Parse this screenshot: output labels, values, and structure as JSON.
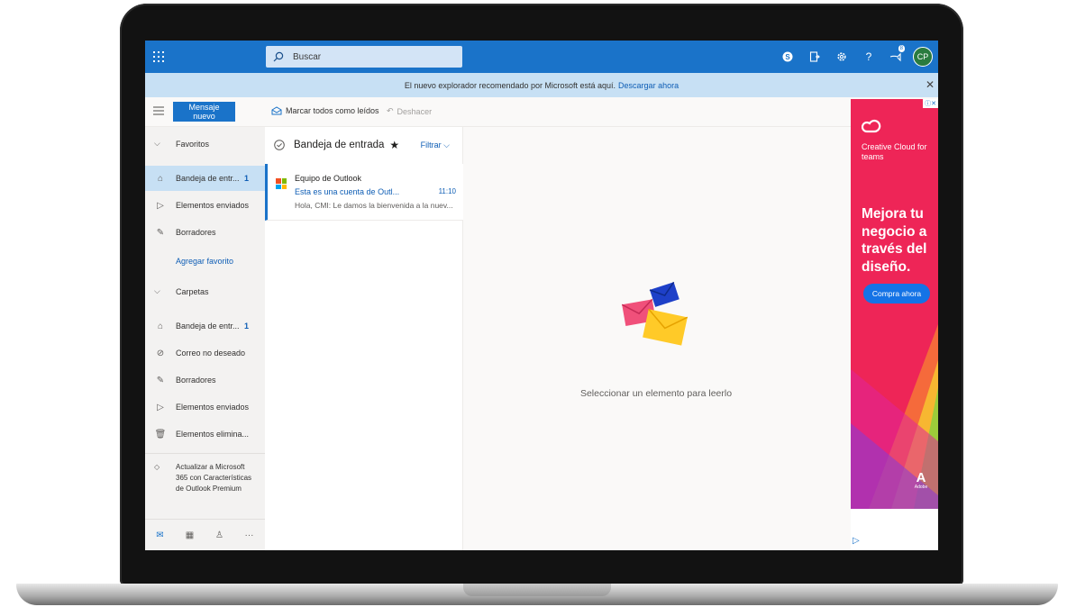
{
  "search": {
    "placeholder": "Buscar"
  },
  "header": {
    "avatar_initials": "CP",
    "notification_count": "8"
  },
  "banner": {
    "text": "El nuevo explorador recomendado por Microsoft está aquí.",
    "link": "Descargar ahora"
  },
  "toolbar": {
    "new_message": "Mensaje nuevo",
    "mark_all_read": "Marcar todos como leídos",
    "undo": "Deshacer"
  },
  "sidebar": {
    "favorites_label": "Favoritos",
    "favorites": [
      {
        "label": "Bandeja de entr...",
        "count": "1",
        "icon": "inbox-icon",
        "selected": true
      },
      {
        "label": "Elementos enviados",
        "count": "",
        "icon": "send-icon"
      },
      {
        "label": "Borradores",
        "count": "",
        "icon": "pencil-icon"
      }
    ],
    "add_favorite": "Agregar favorito",
    "folders_label": "Carpetas",
    "folders": [
      {
        "label": "Bandeja de entr...",
        "count": "1",
        "icon": "inbox-icon"
      },
      {
        "label": "Correo no deseado",
        "count": "",
        "icon": "block-icon"
      },
      {
        "label": "Borradores",
        "count": "",
        "icon": "pencil-icon"
      },
      {
        "label": "Elementos enviados",
        "count": "",
        "icon": "send-icon"
      },
      {
        "label": "Elementos elimina...",
        "count": "",
        "icon": "trash-icon"
      }
    ],
    "upgrade_text": "Actualizar a Microsoft 365 con Características de Outlook Premium"
  },
  "message_list": {
    "title": "Bandeja de entrada",
    "filter": "Filtrar",
    "messages": [
      {
        "sender": "Equipo de Outlook",
        "subject": "Esta es una cuenta de Outl...",
        "time": "11:10",
        "preview": "Hola, CMI: Le damos la bienvenida a la nuev..."
      }
    ]
  },
  "reading_pane": {
    "empty_text": "Seleccionar un elemento para leerlo"
  },
  "ad": {
    "brand": "Creative Cloud for teams",
    "headline": "Mejora tu negocio a través del diseño.",
    "cta": "Compra ahora",
    "logo_text": "Adobe"
  },
  "colors": {
    "accent": "#1a73c9",
    "banner": "#c7e0f4",
    "ad_bg": "#ee2557"
  }
}
